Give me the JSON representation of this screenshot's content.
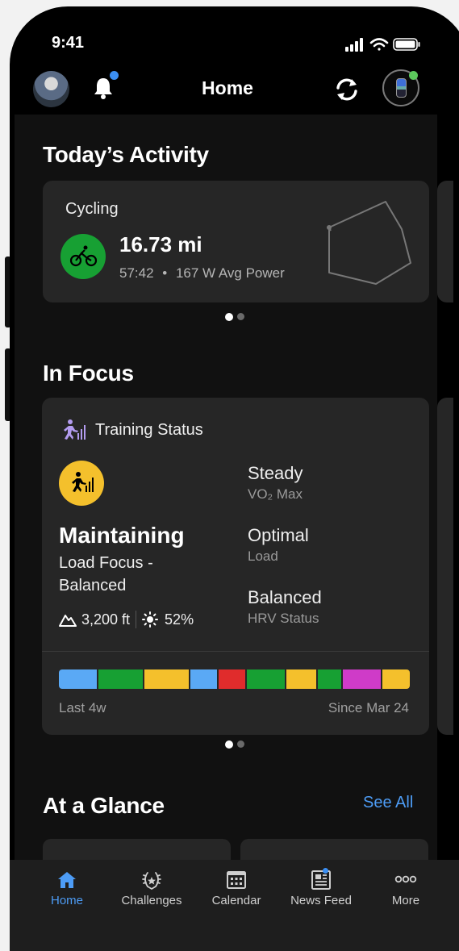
{
  "status_bar": {
    "time": "9:41"
  },
  "header": {
    "title": "Home"
  },
  "todays_activity": {
    "section_title": "Today’s Activity",
    "activity": {
      "type": "Cycling",
      "distance": "16.73 mi",
      "duration": "57:42",
      "separator": "•",
      "avg_power": "167 W Avg Power",
      "icon": "bicycle-icon"
    },
    "pager": {
      "pages": 2,
      "current": 1
    }
  },
  "in_focus": {
    "section_title": "In Focus",
    "training_status": {
      "title": "Training Status",
      "status": "Maintaining",
      "load_focus": "Load Focus - Balanced",
      "altitude": "3,200 ft",
      "heat": "52%",
      "metrics": [
        {
          "value": "Steady",
          "label": "VO₂ Max"
        },
        {
          "value": "Optimal",
          "label": "Load"
        },
        {
          "value": "Balanced",
          "label": "HRV Status"
        }
      ],
      "history_start": "Last 4w",
      "history_end": "Since Mar 24",
      "history_colors": [
        "#5aa9f5",
        "#17a033",
        "#f4c02c",
        "#5aa9f5",
        "#e02c2c",
        "#17a033",
        "#f4c02c",
        "#17a033",
        "#cf3bc8",
        "#f4c02c"
      ],
      "accent_color": "#f4c02c",
      "icon_color": "#b39cf0"
    },
    "pager": {
      "pages": 2,
      "current": 1
    }
  },
  "at_a_glance": {
    "section_title": "At a Glance",
    "see_all": "See All"
  },
  "tabbar": {
    "tabs": [
      {
        "label": "Home",
        "icon": "home-icon",
        "active": true
      },
      {
        "label": "Challenges",
        "icon": "laurel-icon",
        "active": false
      },
      {
        "label": "Calendar",
        "icon": "calendar-icon",
        "active": false
      },
      {
        "label": "News Feed",
        "icon": "newspaper-icon",
        "active": false
      },
      {
        "label": "More",
        "icon": "more-icon",
        "active": false
      }
    ]
  },
  "colors": {
    "accent": "#4d9cf5",
    "card": "#262626",
    "background": "#000000"
  }
}
